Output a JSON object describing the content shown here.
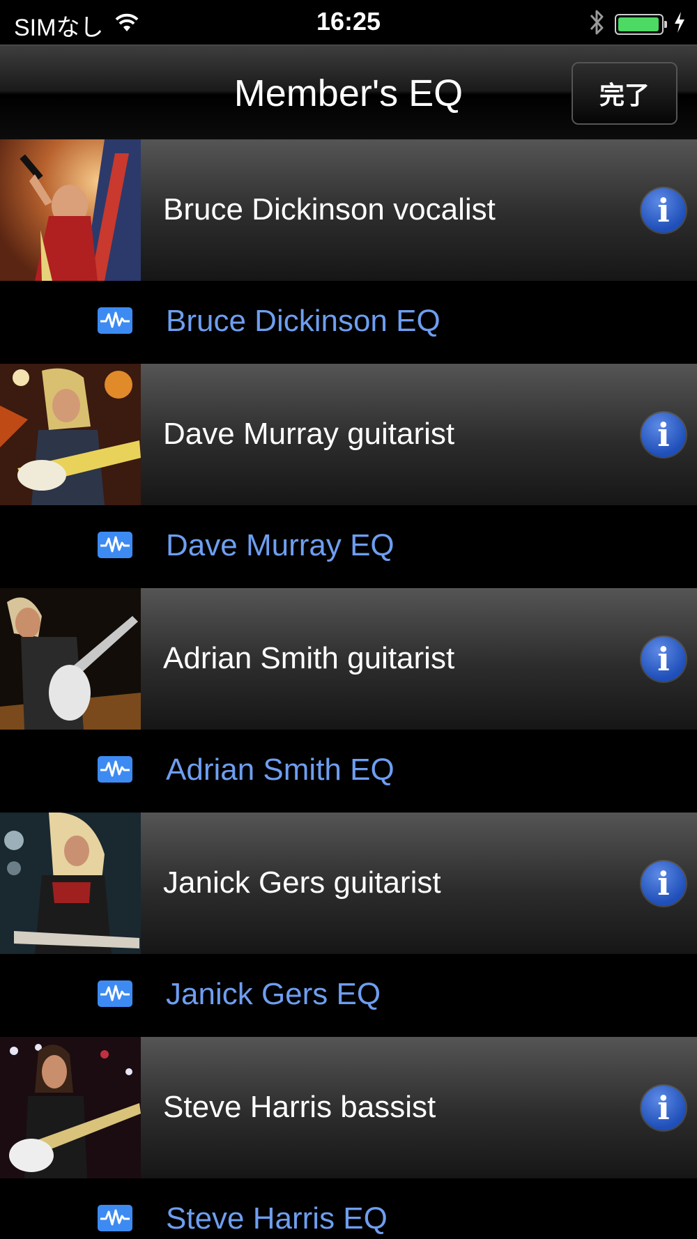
{
  "status_bar": {
    "carrier": "SIMなし",
    "time": "16:25",
    "icons": [
      "wifi-icon",
      "bluetooth-icon",
      "battery-icon",
      "charging-bolt-icon"
    ]
  },
  "nav": {
    "title": "Member's EQ",
    "done_label": "完了"
  },
  "colors": {
    "eq_link": "#6e9ef0",
    "info_blue": "#1f4fb8",
    "battery_green": "#4cd964"
  },
  "members": [
    {
      "name": "Bruce Dickinson vocalist",
      "eq": "Bruce Dickinson EQ",
      "photo": "photo-vocalist-with-microphone"
    },
    {
      "name": "Dave Murray guitarist",
      "eq": "Dave Murray EQ",
      "photo": "photo-guitarist-on-stage"
    },
    {
      "name": "Adrian Smith guitarist",
      "eq": "Adrian Smith EQ",
      "photo": "photo-guitarist-leaning-back"
    },
    {
      "name": "Janick Gers guitarist",
      "eq": "Janick Gers EQ",
      "photo": "photo-guitarist-long-hair"
    },
    {
      "name": "Steve Harris bassist",
      "eq": "Steve Harris EQ",
      "photo": "photo-bassist-on-stage"
    }
  ]
}
